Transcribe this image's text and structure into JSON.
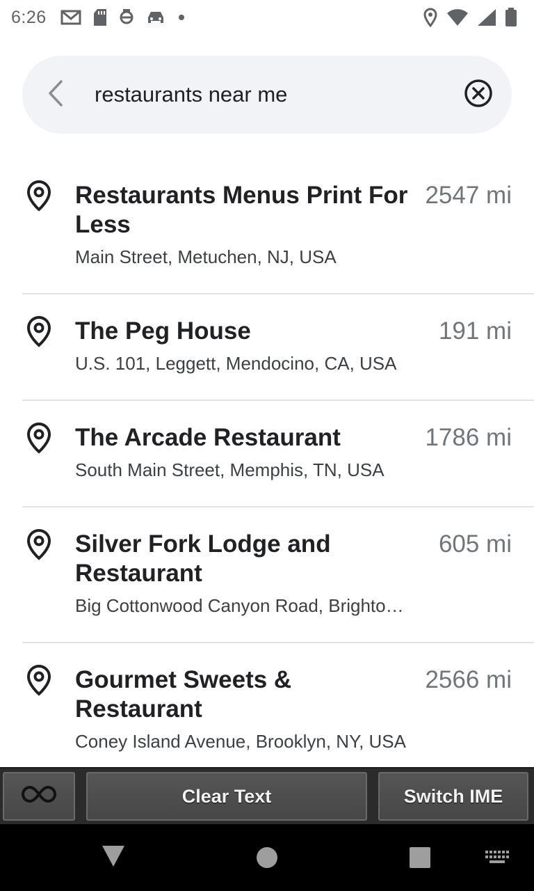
{
  "status_bar": {
    "time": "6:26",
    "left_icons": [
      "gmail-icon",
      "sd-card-icon",
      "sync-icon",
      "car-icon",
      "dot-icon"
    ],
    "right_icons": [
      "location-icon",
      "wifi-icon",
      "signal-icon",
      "battery-icon"
    ]
  },
  "search": {
    "value": "restaurants near me"
  },
  "results": [
    {
      "title": "Restaurants Menus Print For Less",
      "distance": "2547 mi",
      "address": "Main Street, Metuchen, NJ, USA"
    },
    {
      "title": "The Peg House",
      "distance": "191 mi",
      "address": "U.S. 101, Leggett, Mendocino, CA, USA"
    },
    {
      "title": "The Arcade Restaurant",
      "distance": "1786 mi",
      "address": "South Main Street, Memphis, TN, USA"
    },
    {
      "title": "Silver Fork Lodge and Restaurant",
      "distance": "605 mi",
      "address": "Big Cottonwood Canyon Road, Brighto…"
    },
    {
      "title": "Gourmet Sweets & Restaurant",
      "distance": "2566 mi",
      "address": "Coney Island Avenue, Brooklyn, NY, USA"
    }
  ],
  "ime_bar": {
    "clear_label": "Clear Text",
    "switch_label": "Switch IME"
  },
  "colors": {
    "search_bg": "#f1f3f6",
    "distance": "#70757a",
    "ime_bg": "#2b2b2b"
  }
}
